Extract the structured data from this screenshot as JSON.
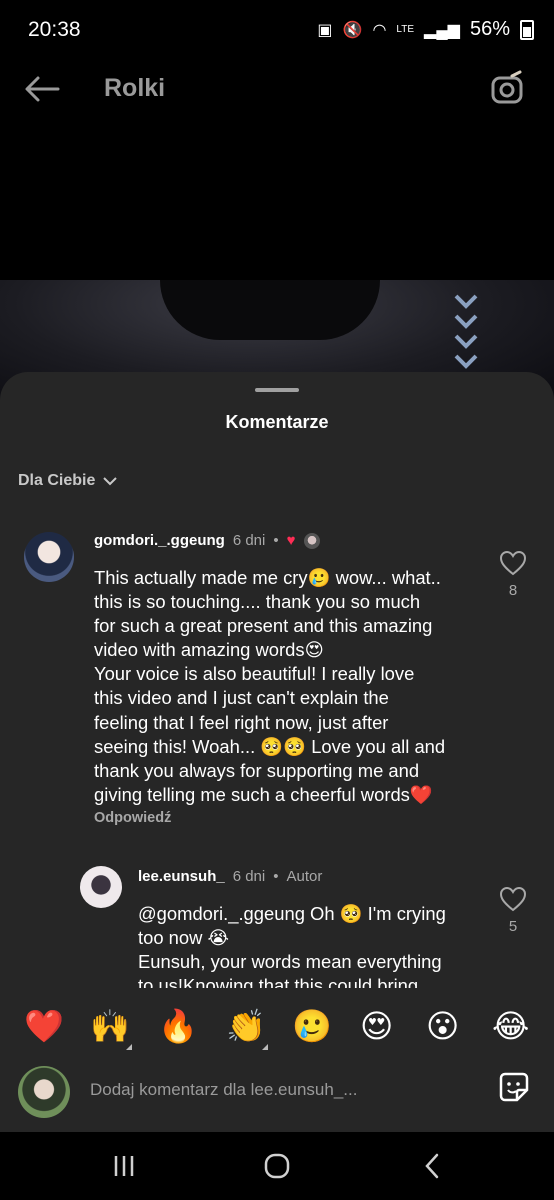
{
  "status": {
    "time": "20:38",
    "network": "LTE",
    "battery": "56%"
  },
  "topbar": {
    "title": "Rolki",
    "back_icon": "arrow-left-icon",
    "camera_icon": "camera-icon"
  },
  "sheet": {
    "title": "Komentarze",
    "sort_label": "Dla Ciebie"
  },
  "comments": [
    {
      "username": "gomdori._.ggeung",
      "time": "6 dni",
      "text": "This actually made me cry🥲 wow... what..\nthis is so touching.... thank you so much\nfor such a great present and this amazing\nvideo with amazing words😍\nYour voice is also beautiful! I really love\nthis video and I just can't explain the\nfeeling that I feel right now, just after\nseeing this! Woah... 🥺🥺 Love you all and\nthank you always for supporting me and\ngiving telling me such a cheerful words❤️",
      "reply_label": "Odpowiedź",
      "likes": "8"
    },
    {
      "username": "lee.eunsuh_",
      "time": "6 dni",
      "badge": "Autor",
      "text": "@gomdori._.ggeung Oh 🥺 I'm crying\ntoo now 😭\nEunsuh, your words mean everything\nto us!Knowing that this could bring",
      "likes": "5"
    }
  ],
  "emoji_bar": [
    "❤️",
    "🙌",
    "🔥",
    "👏",
    "🥲",
    "😍",
    "😮",
    "😂"
  ],
  "input": {
    "placeholder": "Dodaj komentarz dla lee.eunsuh_..."
  },
  "colors": {
    "sheet_bg": "#262626",
    "like_red": "#ff2d55",
    "muted_text": "#a8a8a8"
  }
}
